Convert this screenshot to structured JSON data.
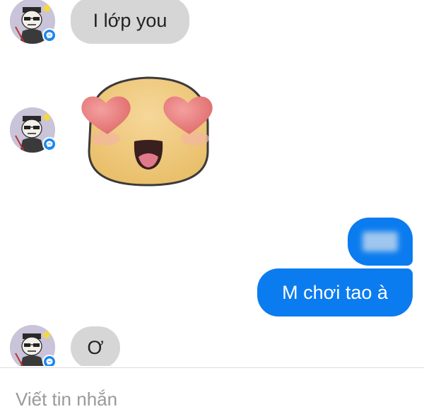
{
  "messages": [
    {
      "sender": "contact",
      "text": "I lớp you"
    },
    {
      "sender": "contact",
      "sticker": "heart-eyes-emoji"
    },
    {
      "sender": "me",
      "text_redacted": true
    },
    {
      "sender": "me",
      "text": "M chơi tao à"
    },
    {
      "sender": "contact",
      "text": "Ơ"
    }
  ],
  "composer": {
    "placeholder": "Viết tin nhắn"
  },
  "colors": {
    "outgoing_bubble": "#0b7cef",
    "incoming_bubble": "#d6d6d6",
    "messenger_badge": "#1a86f0",
    "avatar_bg": "#c8c3d8"
  },
  "icons": {
    "badge": "messenger-icon",
    "sticker": "heart-eyes-emoji"
  }
}
